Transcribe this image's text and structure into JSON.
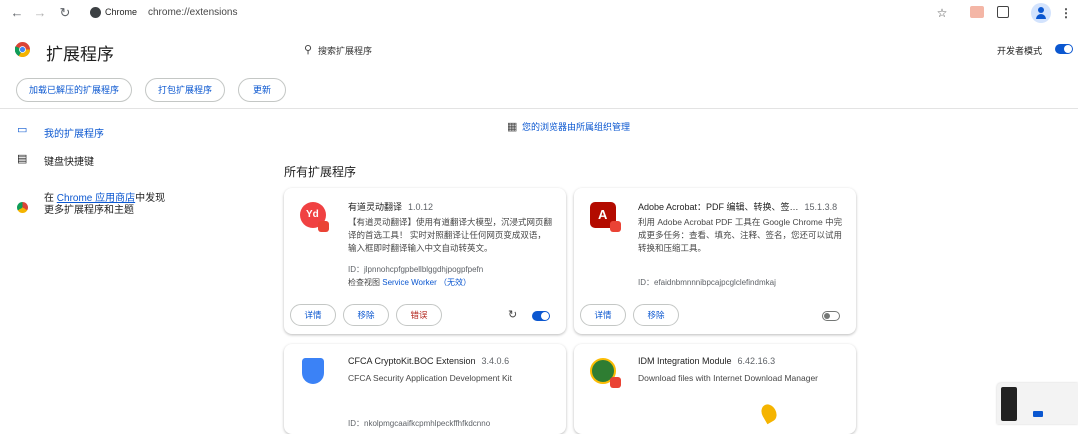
{
  "browser": {
    "back_icon": "←",
    "forward_icon": "→",
    "reload_icon": "↻",
    "site_label": "Chrome",
    "url": "chrome://extensions",
    "bookmark_icon": "☆",
    "menu_icon": "⋮"
  },
  "header": {
    "title": "扩展程序",
    "search_placeholder": "搜索扩展程序",
    "dev_mode_label": "开发者模式"
  },
  "actions": {
    "load_unpacked": "加载已解压的扩展程序",
    "pack": "打包扩展程序",
    "update": "更新"
  },
  "sidebar": {
    "my_extensions": "我的扩展程序",
    "shortcuts": "键盘快捷键",
    "store_prefix": "在",
    "store_link": "Chrome 应用商店",
    "store_suffix": "中发现",
    "store_line2": "更多扩展程序和主题"
  },
  "notice": "您的浏览器由所属组织管理",
  "section_title": "所有扩展程序",
  "cards": [
    {
      "name": "有道灵动翻译",
      "version": "1.0.12",
      "description": "【有道灵动翻译】使用有道翻译大模型，沉浸式网页翻译的首选工具！ 实时对照翻译让任何网页变成双语，输入框即时翻译输入中文自动转英文。",
      "id": "ID：jlpnnohcpfgpbellblggdhjpogpfpefn",
      "inspect_prefix": "检查视图",
      "inspect_link": "Service Worker （无效）",
      "btn_details": "详情",
      "btn_remove": "移除",
      "btn_errors": "错误",
      "enabled": true
    },
    {
      "name": "Adobe Acrobat：PDF 编辑、转换、签…",
      "version": "15.1.3.8",
      "description": "利用 Adobe Acrobat PDF 工具在 Google Chrome 中完成更多任务：查看、填充、注释、签名，您还可以试用转换和压缩工具。",
      "id": "ID：efaidnbmnnnibpcajpcglclefindmkaj",
      "btn_details": "详情",
      "btn_remove": "移除",
      "enabled": false
    },
    {
      "name": "CFCA CryptoKit.BOC Extension",
      "version": "3.4.0.6",
      "description": "CFCA Security Application Development Kit",
      "id": "ID：nkolpmgcaaifkcpmhlpeckffhfkdcnno"
    },
    {
      "name": "IDM Integration Module",
      "version": "6.42.16.3",
      "description": "Download files with Internet Download Manager"
    }
  ]
}
